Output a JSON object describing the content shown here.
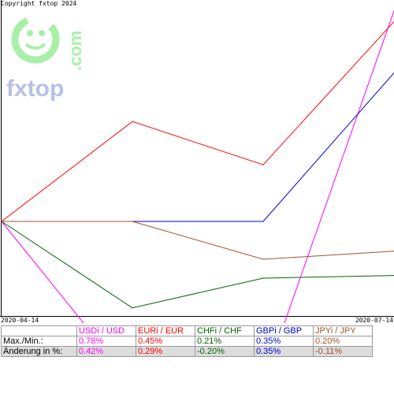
{
  "copyright": "Copyright fxtop 2024",
  "logo": {
    "brand": "fxtop",
    "tld": ".com",
    "color": "#90ee90",
    "text_color": "#9aa6d6"
  },
  "chart_data": {
    "type": "line",
    "x": [
      "2020-04-14",
      "2020-05-14",
      "2020-06-14",
      "2020-07-14"
    ],
    "xlabel_start": "2020-04-14",
    "xlabel_end": "2020-07-14",
    "ylim": [
      -0.35,
      0.82
    ],
    "series": [
      {
        "name": "USDi / USD",
        "color": "#ff00ff",
        "values": [
          0.0,
          -0.6,
          -0.6,
          0.78
        ]
      },
      {
        "name": "EURi / EUR",
        "color": "#ff0000",
        "values": [
          0.0,
          0.37,
          0.21,
          0.74
        ]
      },
      {
        "name": "CHFi / CHF",
        "color": "#006400",
        "values": [
          0.0,
          -0.32,
          -0.21,
          -0.2
        ]
      },
      {
        "name": "GBPi / GBP",
        "color": "#0000cc",
        "values": [
          0.0,
          0.0,
          0.0,
          0.55
        ]
      },
      {
        "name": "JPYi / JPY",
        "color": "#a0522d",
        "values": [
          0.0,
          0.0,
          -0.14,
          -0.11
        ]
      }
    ]
  },
  "legend": {
    "headers": [
      "USDi / USD",
      "EURi / EUR",
      "CHFi / CHF",
      "GBPi / GBP",
      "JPYi / JPY"
    ],
    "colors": [
      "#ff00ff",
      "#ff0000",
      "#006400",
      "#0000cc",
      "#a0522d"
    ],
    "row_max_label": "Max./Min.:",
    "row_max": [
      "0.78%",
      "0.45%",
      "0.21%",
      "0.35%",
      "0.20%"
    ],
    "row_chg_label": "Änderung in %:",
    "row_chg": [
      "0.42%",
      "0.29%",
      "-0.20%",
      "0.35%",
      "-0.11%"
    ]
  }
}
